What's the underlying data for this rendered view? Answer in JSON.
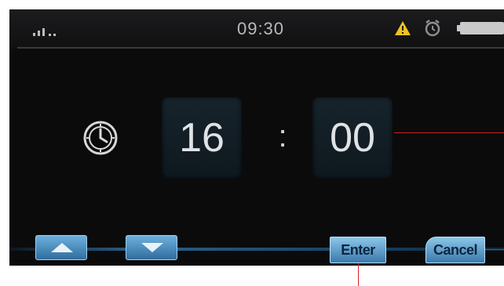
{
  "status_bar": {
    "time": "09:30",
    "icons": [
      "signal-icon",
      "warning-icon",
      "alarm-clock-icon",
      "battery-icon"
    ]
  },
  "time_setting": {
    "icon": "clock-icon",
    "hours": "16",
    "separator": ":",
    "minutes": "00"
  },
  "buttons": {
    "up": "arrow-up",
    "down": "arrow-down",
    "enter_label": "Enter",
    "cancel_label": "Cancel"
  },
  "colors": {
    "screen_background": "#0b0b0c",
    "button_blue": "#4a88b8",
    "warning_yellow": "#f0c21a",
    "callout_red": "#d62020"
  }
}
